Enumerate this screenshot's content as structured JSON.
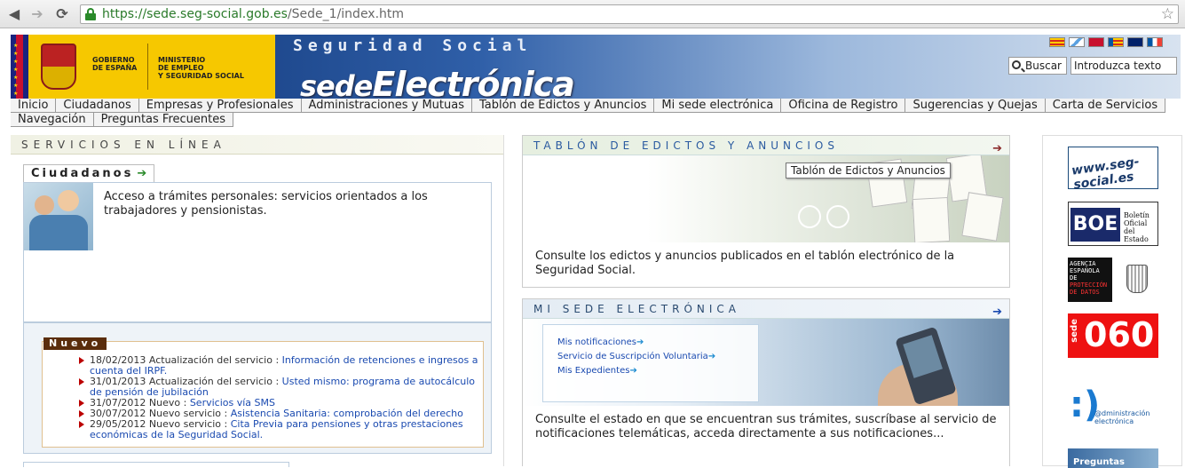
{
  "browser": {
    "url_host": "https://sede.seg-social.gob.es",
    "url_path": "/Sede_1/index.htm"
  },
  "header": {
    "gov_line1": "GOBIERNO",
    "gov_line2": "DE ESPAÑA",
    "min_line1": "MINISTERIO",
    "min_line2": "DE EMPLEO",
    "min_line3": "Y SEGURIDAD SOCIAL",
    "title_top": "Seguridad Social",
    "title_main_a": "sede",
    "title_main_b": "Electrónica",
    "search_label": "Buscar",
    "search_placeholder": "Introduzca texto",
    "flag_colors": [
      "#d52b1e",
      "#ffffff",
      "#c8102e",
      "#ffcc00",
      "#012169",
      "#0055a4"
    ]
  },
  "menu": {
    "row1": [
      "Inicio",
      "Ciudadanos",
      "Empresas y Profesionales",
      "Administraciones y Mutuas",
      "Tablón de Edictos y Anuncios",
      "Mi sede electrónica",
      "Oficina de Registro",
      "Sugerencias y Quejas",
      "Carta de Servicios"
    ],
    "row2": [
      "Navegación",
      "Preguntas Frecuentes"
    ]
  },
  "services": {
    "title": "SERVICIOS EN LÍNEA",
    "tab_label": "Ciudadanos",
    "ciudadanos_text": "Acceso a trámites personales: servicios orientados a los trabajadores y pensionistas.",
    "nuevo_label": "Nuevo",
    "news": [
      {
        "date": "18/02/2013 Actualización del servicio :",
        "link": "Información de retenciones e ingresos a cuenta del IRPF."
      },
      {
        "date": "31/01/2013 Actualización del servicio :",
        "link": "Usted mismo: programa de autocálculo de pensión de jubilación"
      },
      {
        "date": "31/07/2012 Nuevo :",
        "link": "Servicios vía SMS"
      },
      {
        "date": "30/07/2012 Nuevo servicio :",
        "link": "Asistencia Sanitaria: comprobación del derecho"
      },
      {
        "date": "29/05/2012 Nuevo servicio :",
        "link": "Cita Previa para pensiones y otras prestaciones económicas de la Seguridad Social."
      }
    ]
  },
  "tablon": {
    "title": "TABLÓN DE EDICTOS Y ANUNCIOS",
    "tooltip": "Tablón de Edictos y Anuncios",
    "desc": "Consulte los edictos y anuncios publicados en el tablón electrónico de la Seguridad Social."
  },
  "misede": {
    "title": "MI SEDE ELECTRÓNICA",
    "links": [
      "Mis notificaciones",
      "Servicio de Suscripción Voluntaria",
      "Mis Expedientes"
    ],
    "desc": "Consulte el estado en que se encuentran sus trámites, suscríbase al servicio de notificaciones telemáticas, acceda directamente a sus notificaciones..."
  },
  "sidebar": {
    "ws_text": "www.seg-social.es",
    "boe_abbr": "BOE",
    "boe_l1": "Boletín",
    "boe_l2": "Oficial del",
    "boe_l3": "Estado",
    "apd_l1": "AGENCIA",
    "apd_l2": "ESPAÑOLA DE",
    "apd_l3": "PROTECCIÓN",
    "apd_l4": "DE DATOS",
    "s060_a": "sede",
    "s060_b": "060",
    "adm_l1": "@dministración",
    "adm_l2": "electrónica",
    "pf_text": "Preguntas"
  }
}
